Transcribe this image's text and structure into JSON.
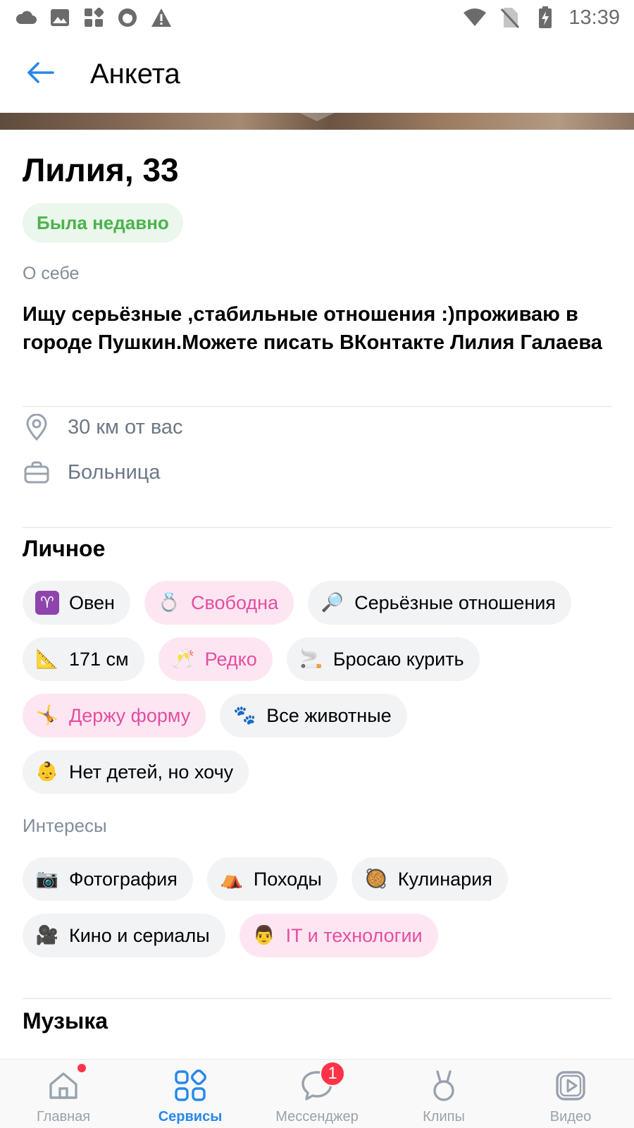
{
  "status_bar": {
    "time": "13:39",
    "left_icons": [
      "cloud-icon",
      "image-icon",
      "apps-icon",
      "firefox-icon",
      "warning-icon"
    ],
    "right_icons": [
      "wifi-icon",
      "no-sim-icon",
      "battery-charging-icon"
    ]
  },
  "header": {
    "title": "Анкета",
    "back_icon": "arrow-left-icon"
  },
  "profile": {
    "name": "Лилия, 33",
    "online_status": "Была недавно",
    "about_label": "О себе",
    "about_text": "Ищу серьёзные ,стабильные отношения :)проживаю в городе Пушкин.Можете писать ВКонтакте Лилия Галаева",
    "distance": "30 км от вас",
    "work": "Больница"
  },
  "personal": {
    "title": "Личное",
    "chips": [
      {
        "emoji": "♈",
        "label": "Овен",
        "highlight": false
      },
      {
        "emoji": "💍",
        "label": "Свободна",
        "highlight": true
      },
      {
        "emoji": "🔎",
        "label": "Серьёзные отношения",
        "highlight": false
      },
      {
        "emoji": "📐",
        "label": "171 см",
        "highlight": false
      },
      {
        "emoji": "🥂",
        "label": "Редко",
        "highlight": true
      },
      {
        "emoji": "🚬",
        "label": "Бросаю курить",
        "highlight": false
      },
      {
        "emoji": "🤸",
        "label": "Держу форму",
        "highlight": true
      },
      {
        "emoji": "🐾",
        "label": "Все животные",
        "highlight": false
      },
      {
        "emoji": "👶",
        "label": "Нет детей, но хочу",
        "highlight": false
      }
    ]
  },
  "interests": {
    "title": "Интересы",
    "chips": [
      {
        "emoji": "📷",
        "label": "Фотография",
        "highlight": false
      },
      {
        "emoji": "⛺",
        "label": "Походы",
        "highlight": false
      },
      {
        "emoji": "🥘",
        "label": "Кулинария",
        "highlight": false
      },
      {
        "emoji": "🎥",
        "label": "Кино и сериалы",
        "highlight": false
      },
      {
        "emoji": "👨",
        "label": "IT и технологии",
        "highlight": true
      }
    ]
  },
  "music": {
    "title": "Музыка"
  },
  "tabbar": {
    "tabs": [
      {
        "label": "Главная",
        "icon": "home-icon",
        "active": false,
        "dot": true
      },
      {
        "label": "Сервисы",
        "icon": "services-grid-icon",
        "active": true
      },
      {
        "label": "Мессенджер",
        "icon": "messenger-icon",
        "active": false,
        "badge": "1"
      },
      {
        "label": "Клипы",
        "icon": "clips-icon",
        "active": false
      },
      {
        "label": "Видео",
        "icon": "video-icon",
        "active": false
      }
    ]
  },
  "colors": {
    "accent": "#2688eb",
    "online_green": "#4bb34b",
    "online_bg": "#ebf6ec",
    "pink_text": "#e64da1",
    "pink_bg": "#fde6f2",
    "chip_bg": "#f2f3f5",
    "secondary_text": "#818c99",
    "badge_red": "#ff3347"
  }
}
